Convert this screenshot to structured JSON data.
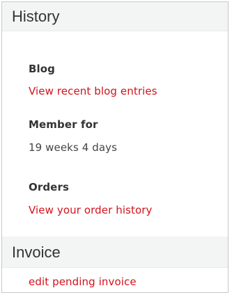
{
  "history": {
    "title": "History",
    "blog_label": "Blog",
    "blog_link": "View recent blog entries",
    "member_label": "Member for",
    "member_value": "19 weeks 4 days",
    "orders_label": "Orders",
    "orders_link": "View your order history"
  },
  "invoice": {
    "title": "Invoice",
    "edit_link": "edit pending invoice"
  },
  "colors": {
    "link": "#d2121c",
    "header_bg": "#f3f4f4"
  }
}
